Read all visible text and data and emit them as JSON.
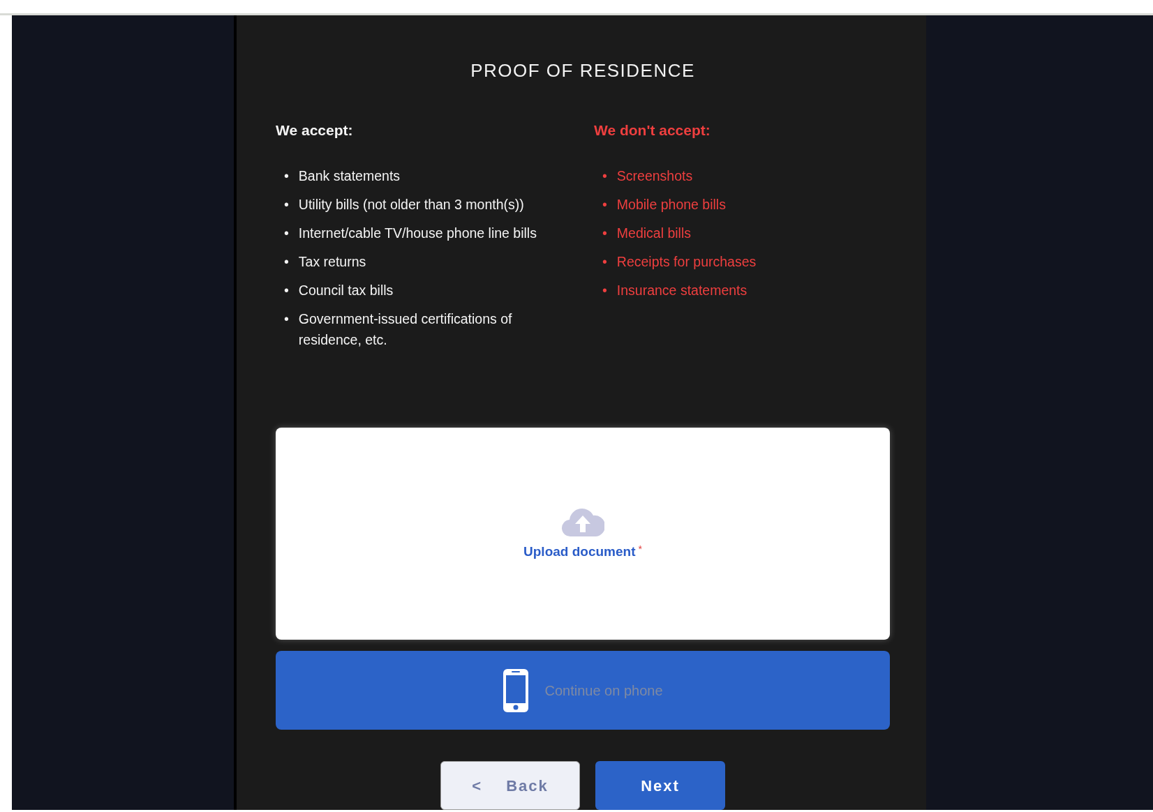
{
  "title": "PROOF OF RESIDENCE",
  "accepted": {
    "heading": "We accept:",
    "bullet": "•",
    "items": [
      "Bank statements",
      "Utility bills (not older than 3 month(s))",
      "Internet/cable TV/house phone line bills",
      "Tax returns",
      "Council tax bills",
      "Government-issued certifications of residence, etc."
    ]
  },
  "rejected": {
    "heading": "We don't accept:",
    "bullet": "•",
    "items": [
      "Screenshots",
      "Mobile phone bills",
      "Medical bills",
      "Receipts for purchases",
      "Insurance statements"
    ]
  },
  "upload": {
    "label": "Upload document",
    "required_mark": "*"
  },
  "phone_button": {
    "label": "Continue on phone"
  },
  "buttons": [
    {
      "kind": "back",
      "arrow": "<",
      "label": "Back"
    },
    {
      "kind": "next",
      "label": "Next"
    }
  ]
}
